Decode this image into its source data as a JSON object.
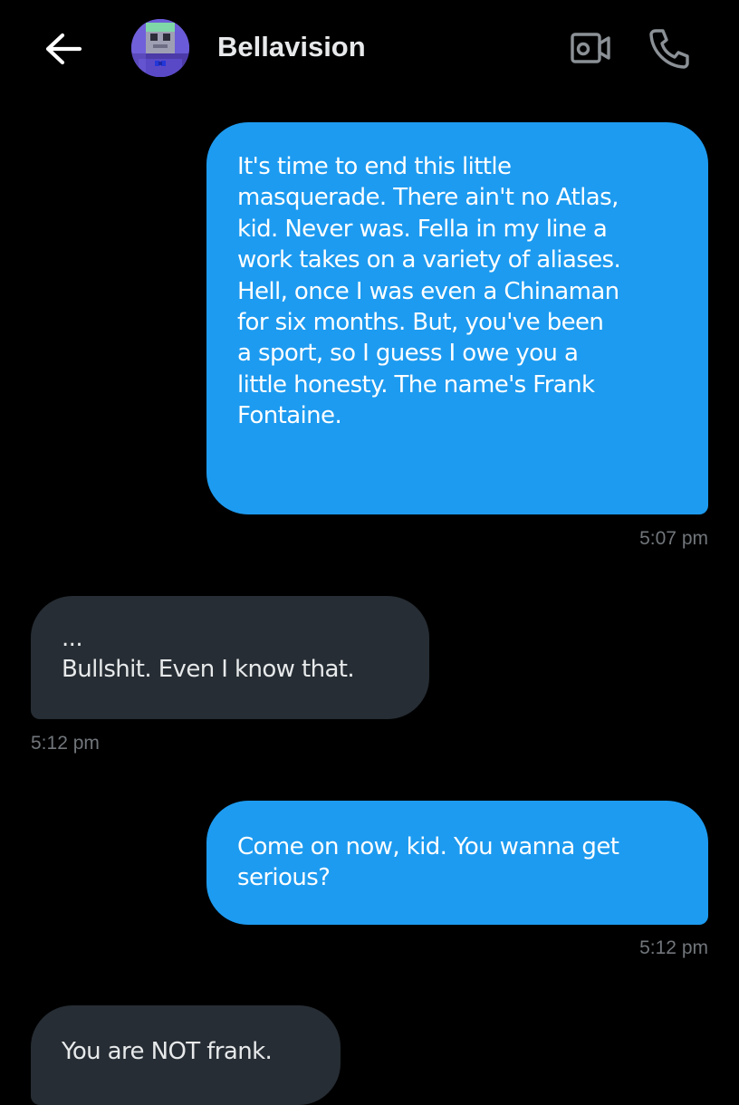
{
  "header": {
    "contact_name": "Bellavision",
    "back_icon": "arrow-left-icon",
    "video_icon": "video-camera-icon",
    "call_icon": "phone-icon"
  },
  "colors": {
    "background": "#000000",
    "sent_bubble": "#1d9bf0",
    "received_bubble": "#262d34",
    "timestamp": "#71767b",
    "text": "#e7e9ea"
  },
  "messages": [
    {
      "direction": "sent",
      "text": "It's time to end this little\nmasquerade. There ain't no Atlas,\nkid. Never was. Fella in my line a\nwork takes on a variety of aliases.\nHell, once I was even a Chinaman\nfor six months. But, you've been\na sport, so I guess I owe you a\nlittle honesty. The name's Frank\nFontaine.",
      "time": "5:07 pm"
    },
    {
      "direction": "received",
      "text": "...\nBullshit. Even I know that.",
      "time": "5:12 pm"
    },
    {
      "direction": "sent",
      "text": "Come on now, kid. You wanna get\nserious?",
      "time": "5:12 pm"
    },
    {
      "direction": "received",
      "text": "You are NOT frank.",
      "time": ""
    }
  ]
}
